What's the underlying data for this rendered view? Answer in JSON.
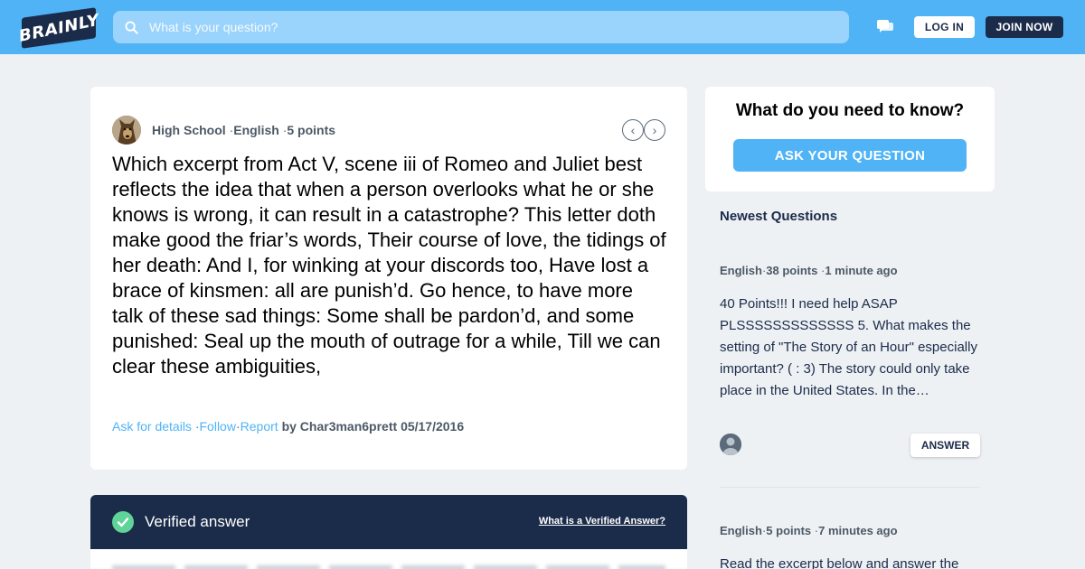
{
  "header": {
    "logo_text": "BRAINLY",
    "search_placeholder": "What is your question?",
    "login_label": "LOG IN",
    "join_label": "JOIN NOW",
    "icons": [
      "search-icon",
      "messages-icon"
    ],
    "accent_color": "#4fb3f6",
    "dark_color": "#1b2b4a"
  },
  "question": {
    "level": "High School",
    "subject": "English",
    "points": "5 points",
    "text": "Which excerpt from Act V, scene iii of Romeo and Juliet best reflects the idea that when a person overlooks what he or she knows is wrong, it can result in a catastrophe? This letter doth make good the friar’s words, Their course of love, the tidings of her death: And I, for winking at your discords too, Have lost a brace of kinsmen: all are punish’d. Go hence, to have more talk of these sad things: Some shall be pardon’d, and some punished: Seal up the mouth of outrage for a while, Till we can clear these ambiguities,",
    "ask_details_label": "Ask for details",
    "follow_label": "Follow",
    "report_label": "Report",
    "by_label": "by",
    "author": "Char3man6prett",
    "date": "05/17/2016",
    "sep": "·"
  },
  "verified": {
    "title": "Verified answer",
    "link": "What is a Verified Answer?",
    "status_color": "#60d399"
  },
  "sidebar": {
    "ask_title": "What do you need to know?",
    "ask_button": "ASK YOUR QUESTION",
    "newest_title": "Newest Questions",
    "questions": [
      {
        "subject": "English",
        "points": "38 points",
        "time": "1 minute ago",
        "text": "40 Points!!! I need help ASAP PLSSSSSSSSSSSSS 5. What makes the setting of \"The Story of an Hour\" especially important? ( : 3) The story could only take place in the United States. In the…",
        "answer_label": "ANSWER"
      },
      {
        "subject": "English",
        "points": "5 points",
        "time": "7 minutes ago",
        "text": "Read the excerpt below and answer the"
      }
    ]
  }
}
